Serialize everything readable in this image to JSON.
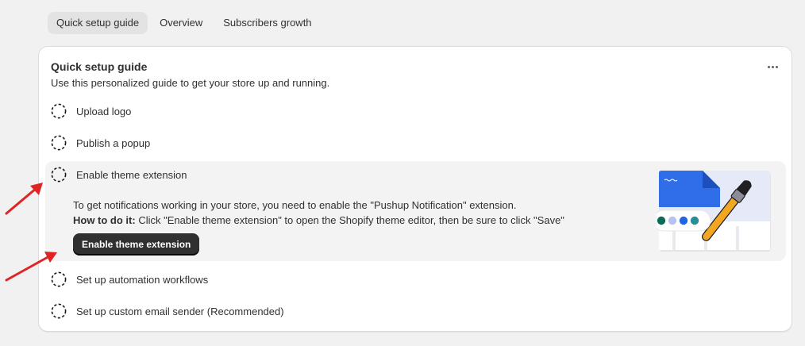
{
  "tabs": [
    {
      "label": "Quick setup guide",
      "active": true
    },
    {
      "label": "Overview",
      "active": false
    },
    {
      "label": "Subscribers growth",
      "active": false
    }
  ],
  "card": {
    "title": "Quick setup guide",
    "subtitle": "Use this personalized guide to get your store up and running."
  },
  "steps": [
    {
      "label": "Upload logo"
    },
    {
      "label": "Publish a popup"
    },
    {
      "label": "Enable theme extension"
    },
    {
      "label": "Set up automation workflows"
    },
    {
      "label": "Set up custom email sender (Recommended)"
    }
  ],
  "expanded": {
    "description": "To get notifications working in your store, you need to enable the \"Pushup Notification\" extension.",
    "howto_label": "How to do it:",
    "howto_text": " Click \"Enable theme extension\" to open the Shopify theme editor, then be sure to click \"Save\"",
    "button_label": "Enable theme extension"
  },
  "colors": {
    "accent_blue": "#2f6ee8",
    "swatches": [
      "#0b6b57",
      "#b9c2ee",
      "#1f66e0",
      "#2b8d97"
    ],
    "annotation_arrow": "#e02424"
  },
  "icons": {
    "more": "more-horizontal-icon",
    "step_status": "dashed-circle-icon",
    "illustration": "theme-paint-brush-illustration",
    "annotation": "red-arrow-icon"
  }
}
